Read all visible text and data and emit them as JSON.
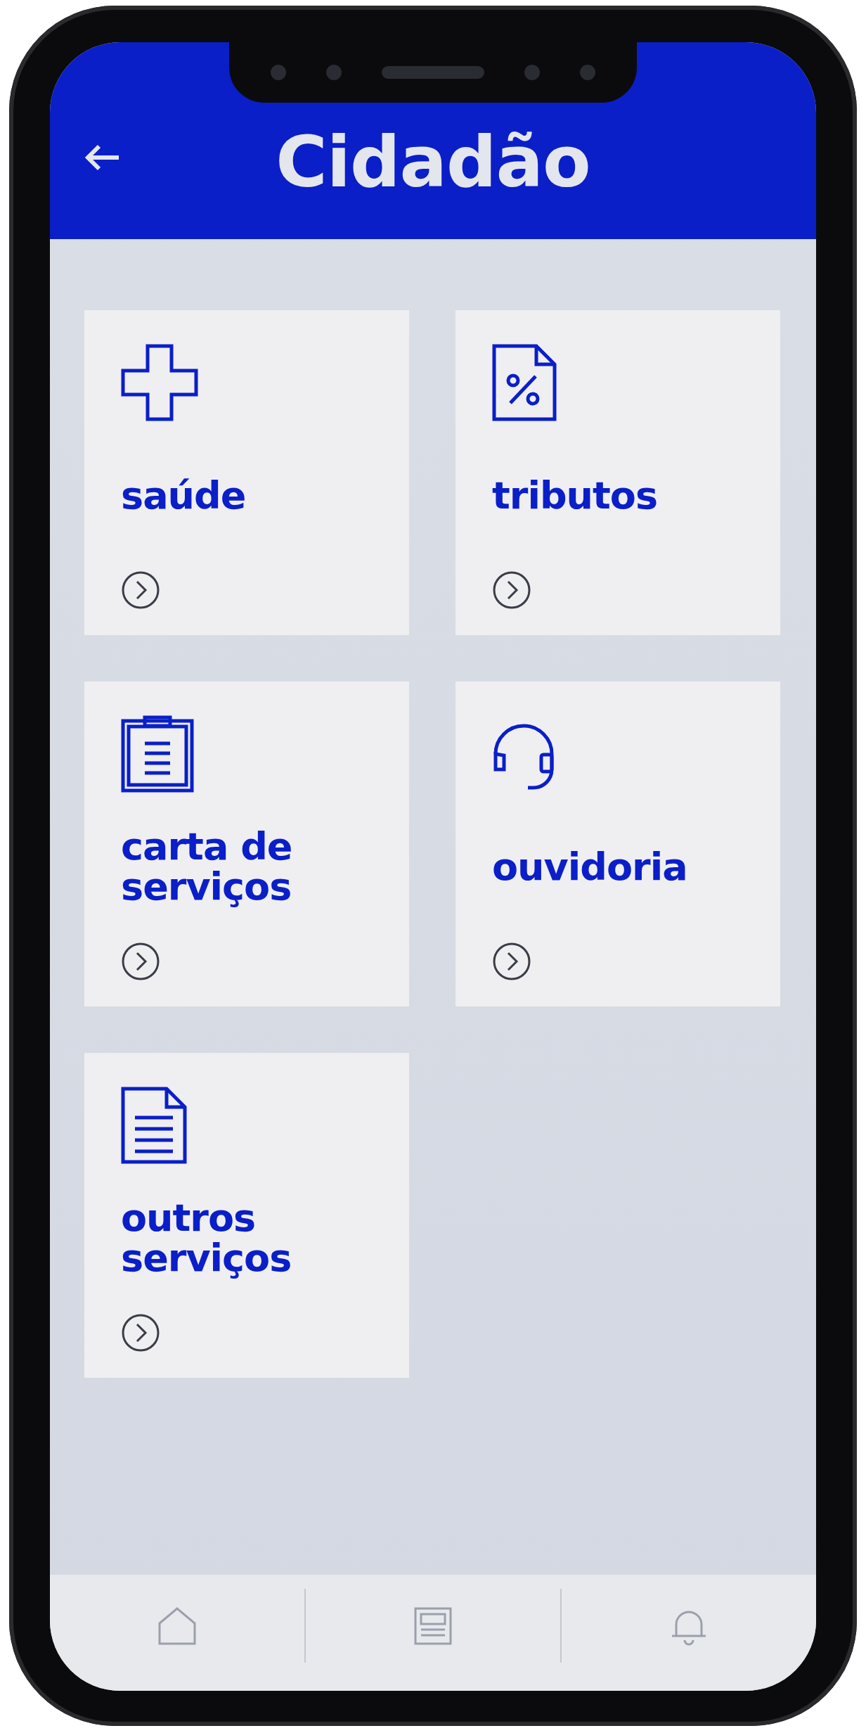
{
  "header": {
    "title": "Cidadão"
  },
  "cards": [
    {
      "label": "saúde",
      "kind": "cross"
    },
    {
      "label": "tributos",
      "kind": "tax"
    },
    {
      "label": "carta de serviços",
      "kind": "clipboard"
    },
    {
      "label": "ouvidoria",
      "kind": "headset"
    },
    {
      "label": "outros serviços",
      "kind": "document"
    }
  ],
  "nav_items": [
    {
      "kind": "home"
    },
    {
      "kind": "news"
    },
    {
      "kind": "bell"
    }
  ]
}
